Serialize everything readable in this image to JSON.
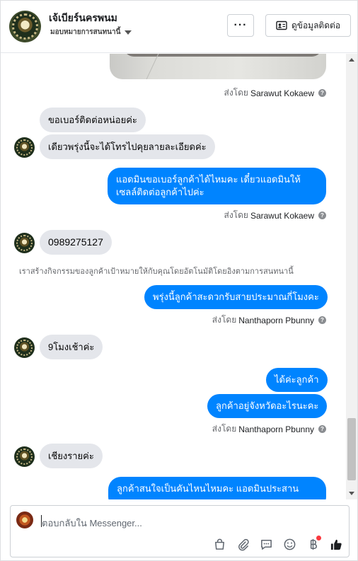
{
  "header": {
    "page_name": "เจ้เบียร์นครพนม",
    "subline": "มอบหมายการสนทนานี้",
    "more_label": "···",
    "contact_label": "ดูข้อมูลติดต่อ"
  },
  "messages": [
    {
      "type": "sent_by",
      "prefix": "ส่งโดย",
      "name": "Sarawut Kokaew"
    },
    {
      "type": "in",
      "text": "ขอเบอร์ติดต่อหน่อยค่ะ"
    },
    {
      "type": "in",
      "text": "เดียวพรุ่งนี้จะได้โทรไปคุยลายละเอียดค่ะ"
    },
    {
      "type": "out",
      "text": "แอดมินขอเบอร์ลูกค้าได้ไหมคะ เดี๋ยวแอดมินให้เซลล์ติดต่อลูกค้าไปค่ะ"
    },
    {
      "type": "sent_by",
      "prefix": "ส่งโดย",
      "name": "Sarawut Kokaew"
    },
    {
      "type": "in",
      "text": "0989275127"
    },
    {
      "type": "system",
      "text": "เราสร้างกิจกรรมของลูกค้าเป้าหมายให้กับคุณโดยอัตโนมัติโดยอิงตามการสนทนานี้"
    },
    {
      "type": "out",
      "text": "พรุ่งนี้ลูกค้าสะดวกรับสายประมาณกี่โมงคะ"
    },
    {
      "type": "sent_by",
      "prefix": "ส่งโดย",
      "name": "Nanthaporn Pbunny"
    },
    {
      "type": "in",
      "text": "9โมงเช้าค่ะ"
    },
    {
      "type": "out",
      "text": "ได้ค่ะลูกค้า"
    },
    {
      "type": "out",
      "text": "ลูกค้าอยู่จังหวัดอะไรนะคะ"
    },
    {
      "type": "sent_by",
      "prefix": "ส่งโดย",
      "name": "Nanthaporn Pbunny"
    },
    {
      "type": "in",
      "text": "เชียงรายค่ะ"
    },
    {
      "type": "out",
      "text": "ลูกค้าสนใจเป็นคันไหนไหมคะ แอดมินประสาน"
    }
  ],
  "composer": {
    "placeholder": "ตอบกลับใน Messenger...",
    "tools": [
      "bag-icon",
      "paperclip-icon",
      "chat-icon",
      "emoji-icon",
      "baht-icon",
      "like-icon"
    ]
  },
  "colors": {
    "outgoing": "#0084ff",
    "incoming": "#e4e6eb",
    "notification": "#fa383e"
  }
}
